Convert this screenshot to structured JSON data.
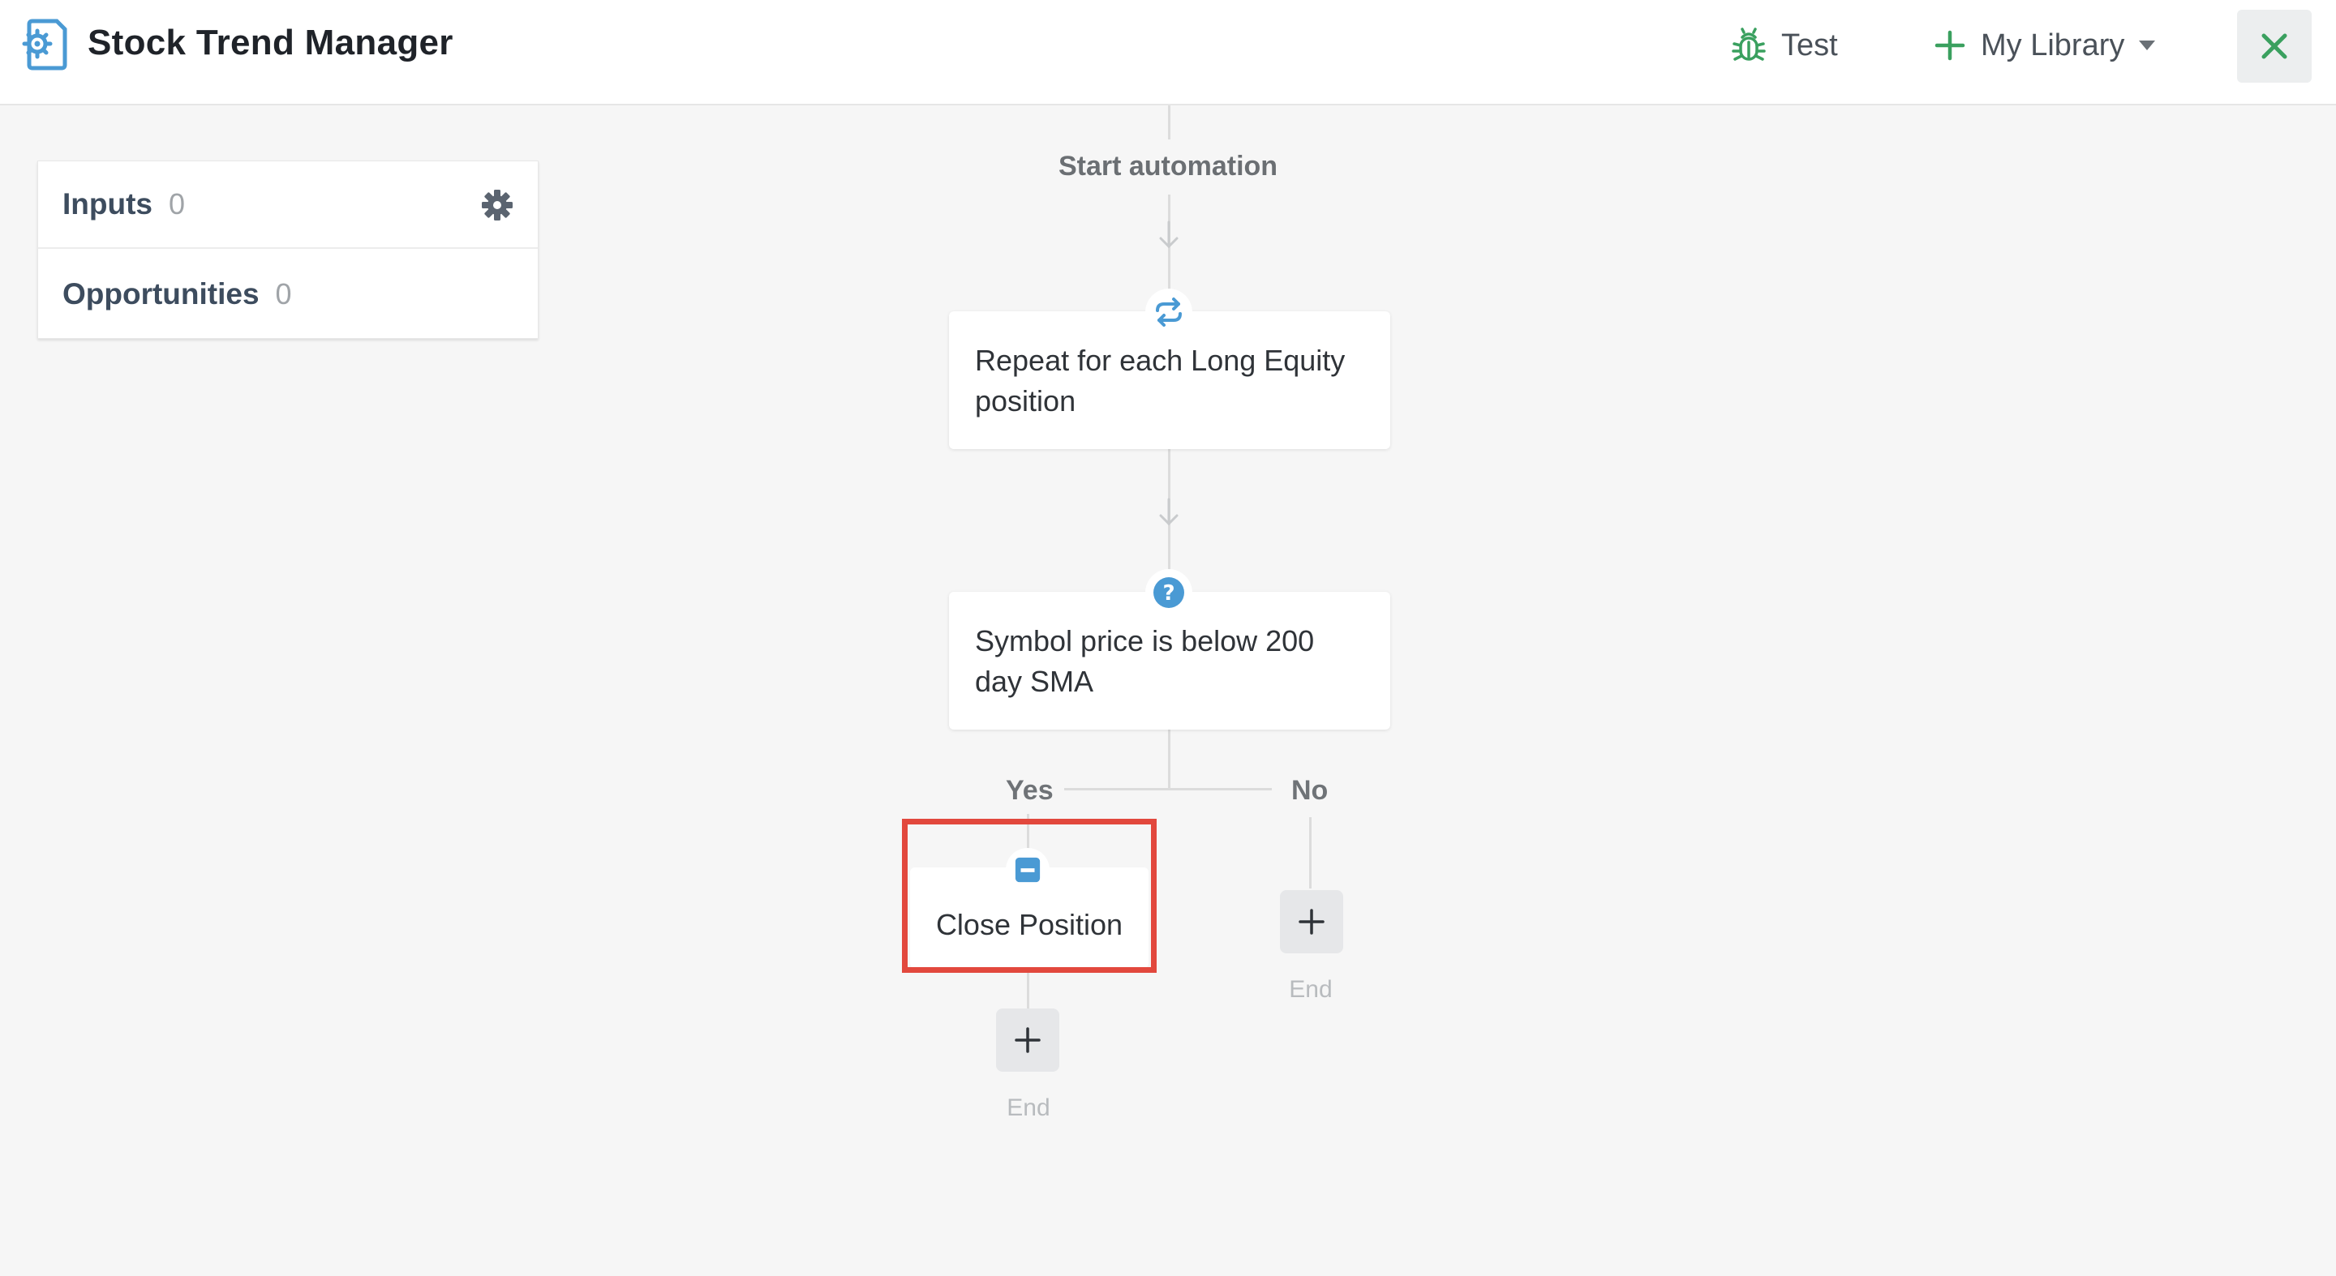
{
  "header": {
    "title": "Stock Trend Manager",
    "logo_icon": "automation-gear-document-icon",
    "test_label": "Test",
    "library_label": "My Library",
    "accent_color": "#3aa05f",
    "close_icon": "close-icon"
  },
  "side_panel": {
    "items": [
      {
        "label": "Inputs",
        "count": "0"
      },
      {
        "label": "Opportunities",
        "count": "0"
      }
    ],
    "settings_icon": "gear-icon"
  },
  "flow": {
    "start_label": "Start automation",
    "steps": [
      {
        "type": "loop",
        "icon": "repeat-icon",
        "text": "Repeat for each Long Equity position"
      },
      {
        "type": "condition",
        "icon": "question-icon",
        "text": "Symbol price is below 200 day SMA"
      }
    ],
    "branches": {
      "yes_label": "Yes",
      "no_label": "No",
      "yes_action": {
        "icon": "minus-square-icon",
        "text": "Close Position",
        "highlighted": true
      },
      "end_label_yes": "End",
      "end_label_no": "End"
    },
    "highlight_color": "#e2483d",
    "icon_color": "#4a9ad4"
  }
}
